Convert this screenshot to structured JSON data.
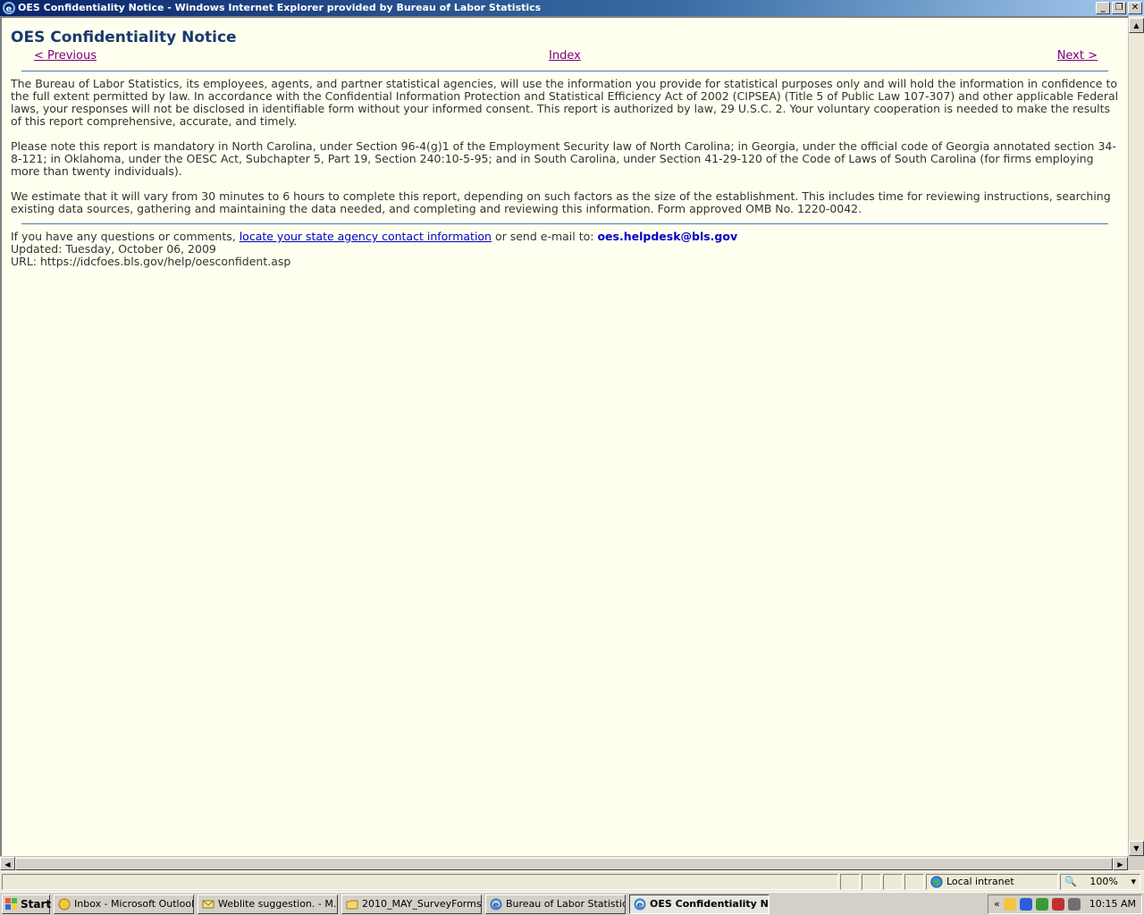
{
  "window": {
    "title": "OES Confidentiality Notice - Windows Internet Explorer provided by Bureau of Labor Statistics",
    "minimize": "_",
    "restore": "❐",
    "close": "✕"
  },
  "page": {
    "title": "OES Confidentiality Notice",
    "nav": {
      "previous": "< Previous",
      "index": "Index",
      "next": "Next >"
    },
    "paragraphs": [
      "The Bureau of Labor Statistics, its employees, agents, and partner statistical agencies, will use the information you provide for statistical purposes only and will hold the information in confidence to the full extent permitted by law. In accordance with the Confidential Information Protection and Statistical Efficiency Act of 2002 (CIPSEA) (Title 5 of Public Law 107-307) and other applicable Federal laws, your responses will not be disclosed in identifiable form without your informed consent. This report is authorized by law, 29 U.S.C. 2. Your voluntary cooperation is needed to make the results of this report comprehensive, accurate, and timely.",
      "Please note this report is mandatory in North Carolina, under Section 96-4(g)1 of the Employment Security law of North Carolina; in Georgia, under the official code of Georgia annotated section 34-8-121; in Oklahoma, under the OESC Act, Subchapter 5, Part 19, Section 240:10-5-95; and in South Carolina, under Section 41-29-120 of the Code of Laws of South Carolina (for firms employing more than twenty individuals).",
      "We estimate that it will vary from 30 minutes to 6 hours to complete this report, depending on such factors as the size of the establishment. This includes time for reviewing instructions, searching existing data sources, gathering and maintaining the data needed, and completing and reviewing this information. Form approved OMB No. 1220-0042."
    ],
    "footer": {
      "contact_prefix": "If you have any questions or comments, ",
      "contact_link": "locate your state agency contact information",
      "contact_mid": " or send e-mail to: ",
      "email": "oes.helpdesk@bls.gov",
      "updated": "Updated: Tuesday, October 06, 2009",
      "url": "URL: https://idcfoes.bls.gov/help/oesconfident.asp"
    }
  },
  "statusbar": {
    "zone": "Local intranet",
    "zoom": "100%"
  },
  "taskbar": {
    "start": "Start",
    "tasks": [
      "Inbox - Microsoft Outlook",
      "Weblite suggestion.  - M...",
      "2010_MAY_SurveyForms",
      "Bureau of Labor Statistic...",
      "OES Confidentiality No..."
    ],
    "tray_chevron": "«",
    "clock": "10:15 AM"
  },
  "colors": {
    "page_bg": "#fffff0",
    "title": "#1a3a6e",
    "link_visited": "#800080",
    "link": "#0000cc",
    "rule": "#4a7ab8"
  }
}
